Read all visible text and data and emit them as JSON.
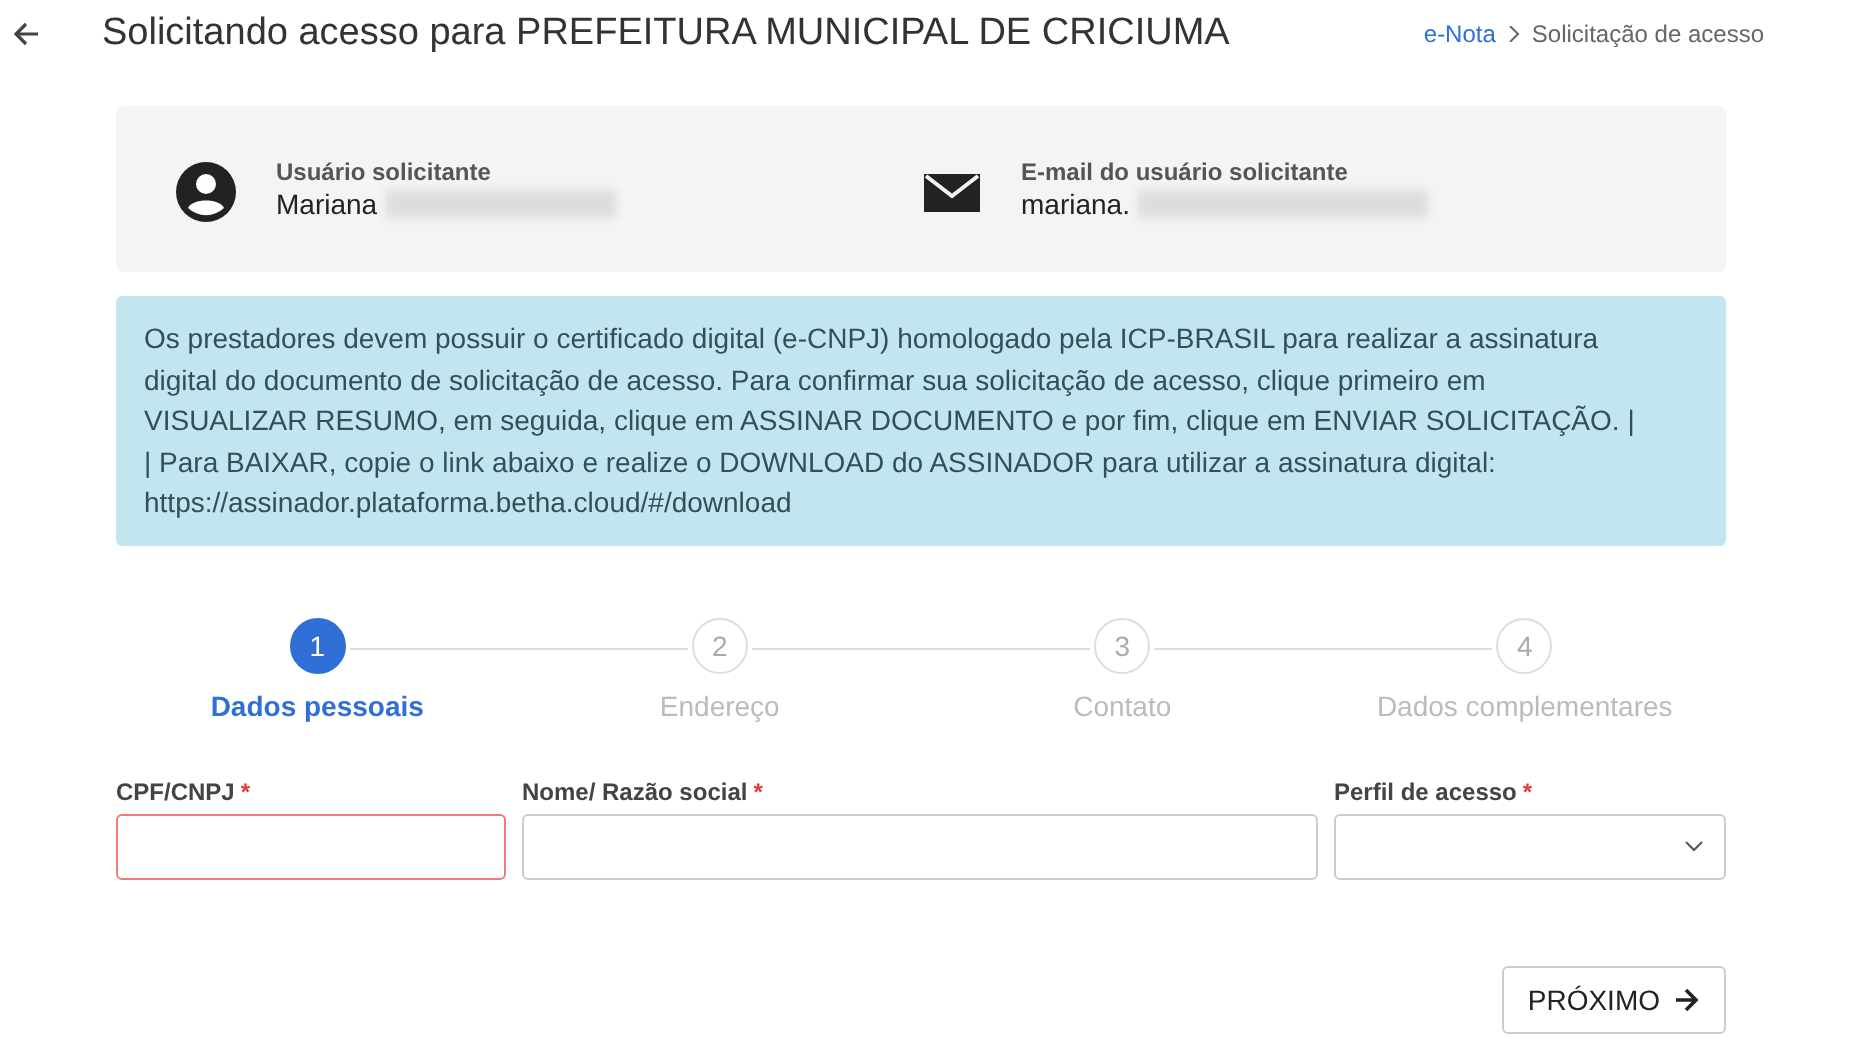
{
  "header": {
    "title": "Solicitando acesso para PREFEITURA MUNICIPAL DE CRICIUMA",
    "breadcrumb": [
      {
        "label": "e-Nota",
        "link": true
      },
      {
        "label": "Solicitação de acesso",
        "link": false
      }
    ]
  },
  "requester": [
    {
      "kind": "user",
      "label": "Usuário solicitante",
      "value": "Mariana",
      "redacted": true
    },
    {
      "kind": "email",
      "label": "E-mail do usuário solicitante",
      "value": "mariana.",
      "redacted": true
    }
  ],
  "notice": "Os prestadores devem possuir o certificado digital (e-CNPJ) homologado pela ICP-BRASIL para realizar a assinatura digital do documento de solicitação de acesso. Para confirmar sua solicitação de acesso, clique primeiro em VISUALIZAR RESUMO, em seguida, clique em ASSINAR DOCUMENTO e por fim, clique em ENVIAR SOLICITAÇÃO. | | Para BAIXAR, copie o link abaixo e realize o DOWNLOAD do ASSINADOR para utilizar a assinatura digital: https://assinador.plataforma.betha.cloud/#/download",
  "steps": [
    {
      "number": "1",
      "label": "Dados pessoais",
      "selected": true
    },
    {
      "number": "2",
      "label": "Endereço",
      "selected": false
    },
    {
      "number": "3",
      "label": "Contato",
      "selected": false
    },
    {
      "number": "4",
      "label": "Dados complementares",
      "selected": false
    }
  ],
  "fields": [
    {
      "kind": "text",
      "label": "CPF/CNPJ",
      "required_mark": "*",
      "invalid": true
    },
    {
      "kind": "text",
      "label": "Nome/ Razão social",
      "required_mark": "*",
      "invalid": false
    },
    {
      "kind": "select",
      "label": "Perfil de acesso",
      "required_mark": "*",
      "invalid": false
    }
  ],
  "next_button": "PRÓXIMO"
}
